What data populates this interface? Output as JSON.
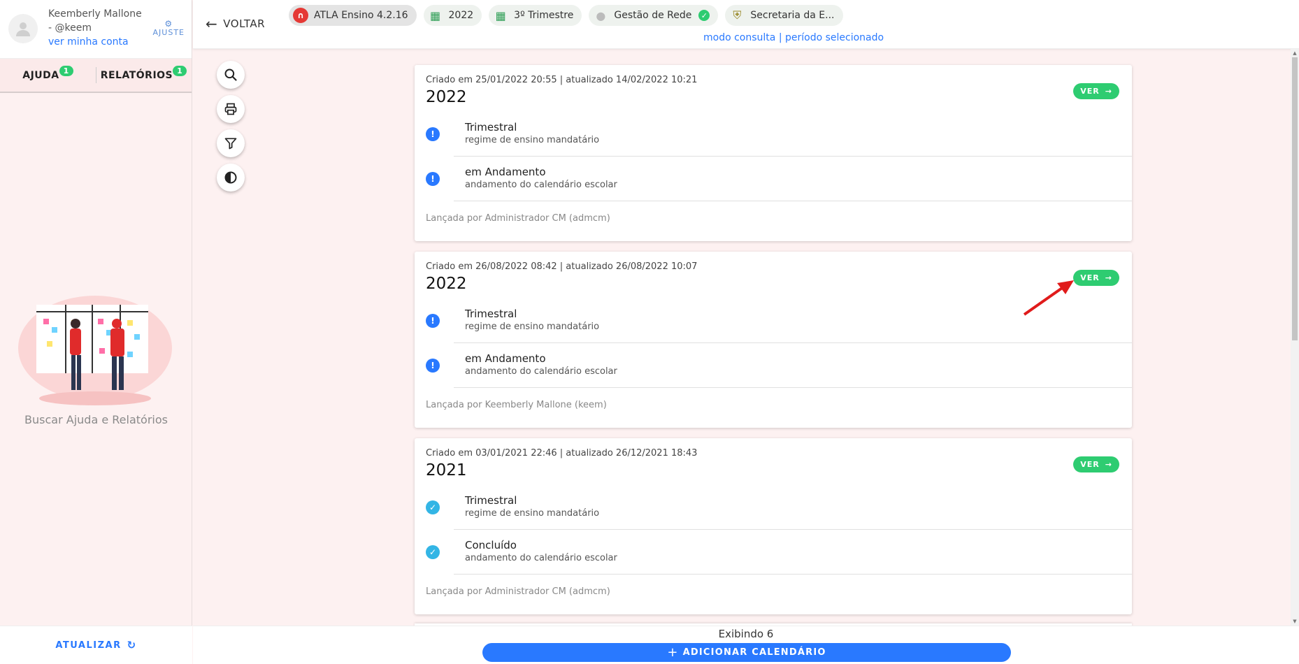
{
  "user": {
    "name_line1": "Keemberly Mallone",
    "name_line2": "- @keem",
    "account_link": "ver minha conta",
    "settings_label": "AJUSTE"
  },
  "sidebar": {
    "tabs": [
      {
        "label": "AJUDA",
        "badge": "1"
      },
      {
        "label": "RELATÓRIOS",
        "badge": "1"
      }
    ],
    "help_text": "Buscar Ajuda e Relatórios",
    "refresh_label": "ATUALIZAR"
  },
  "topbar": {
    "back_label": "VOLTAR",
    "chips": [
      {
        "label": "ATLA Ensino 4.2.16",
        "icon": "app-logo-icon"
      },
      {
        "label": "2022",
        "icon": "calendar-icon"
      },
      {
        "label": "3º Trimestre",
        "icon": "calendar-icon"
      },
      {
        "label": "Gestão de Rede",
        "icon": "person-icon"
      },
      {
        "label": "Secretaria da E...",
        "icon": "crest-icon"
      }
    ],
    "mode_text": "modo consulta | período selecionado"
  },
  "tools": [
    "search-icon",
    "print-icon",
    "filter-icon",
    "contrast-icon"
  ],
  "cards": [
    {
      "meta": "Criado em 25/01/2022 20:55 | atualizado 14/02/2022 10:21",
      "year": "2022",
      "ver_label": "VER",
      "rows": [
        {
          "title": "Trimestral",
          "subtitle": "regime de ensino mandatário",
          "status": "warn"
        },
        {
          "title": "em Andamento",
          "subtitle": "andamento do calendário escolar",
          "status": "warn"
        }
      ],
      "footer": "Lançada por Administrador CM (admcm)"
    },
    {
      "meta": "Criado em 26/08/2022 08:42 | atualizado 26/08/2022 10:07",
      "year": "2022",
      "ver_label": "VER",
      "rows": [
        {
          "title": "Trimestral",
          "subtitle": "regime de ensino mandatário",
          "status": "warn"
        },
        {
          "title": "em Andamento",
          "subtitle": "andamento do calendário escolar",
          "status": "warn"
        }
      ],
      "footer": "Lançada por Keemberly Mallone (keem)"
    },
    {
      "meta": "Criado em 03/01/2021 22:46 | atualizado 26/12/2021 18:43",
      "year": "2021",
      "ver_label": "VER",
      "rows": [
        {
          "title": "Trimestral",
          "subtitle": "regime de ensino mandatário",
          "status": "done"
        },
        {
          "title": "Concluído",
          "subtitle": "andamento do calendário escolar",
          "status": "done"
        }
      ],
      "footer": "Lançada por Administrador CM (admcm)"
    }
  ],
  "bottom": {
    "count_text": "Exibindo 6",
    "add_label": "ADICIONAR CALENDÁRIO"
  },
  "colors": {
    "accent": "#2979ff",
    "success": "#2ecc71",
    "background": "#fdf1f1"
  }
}
